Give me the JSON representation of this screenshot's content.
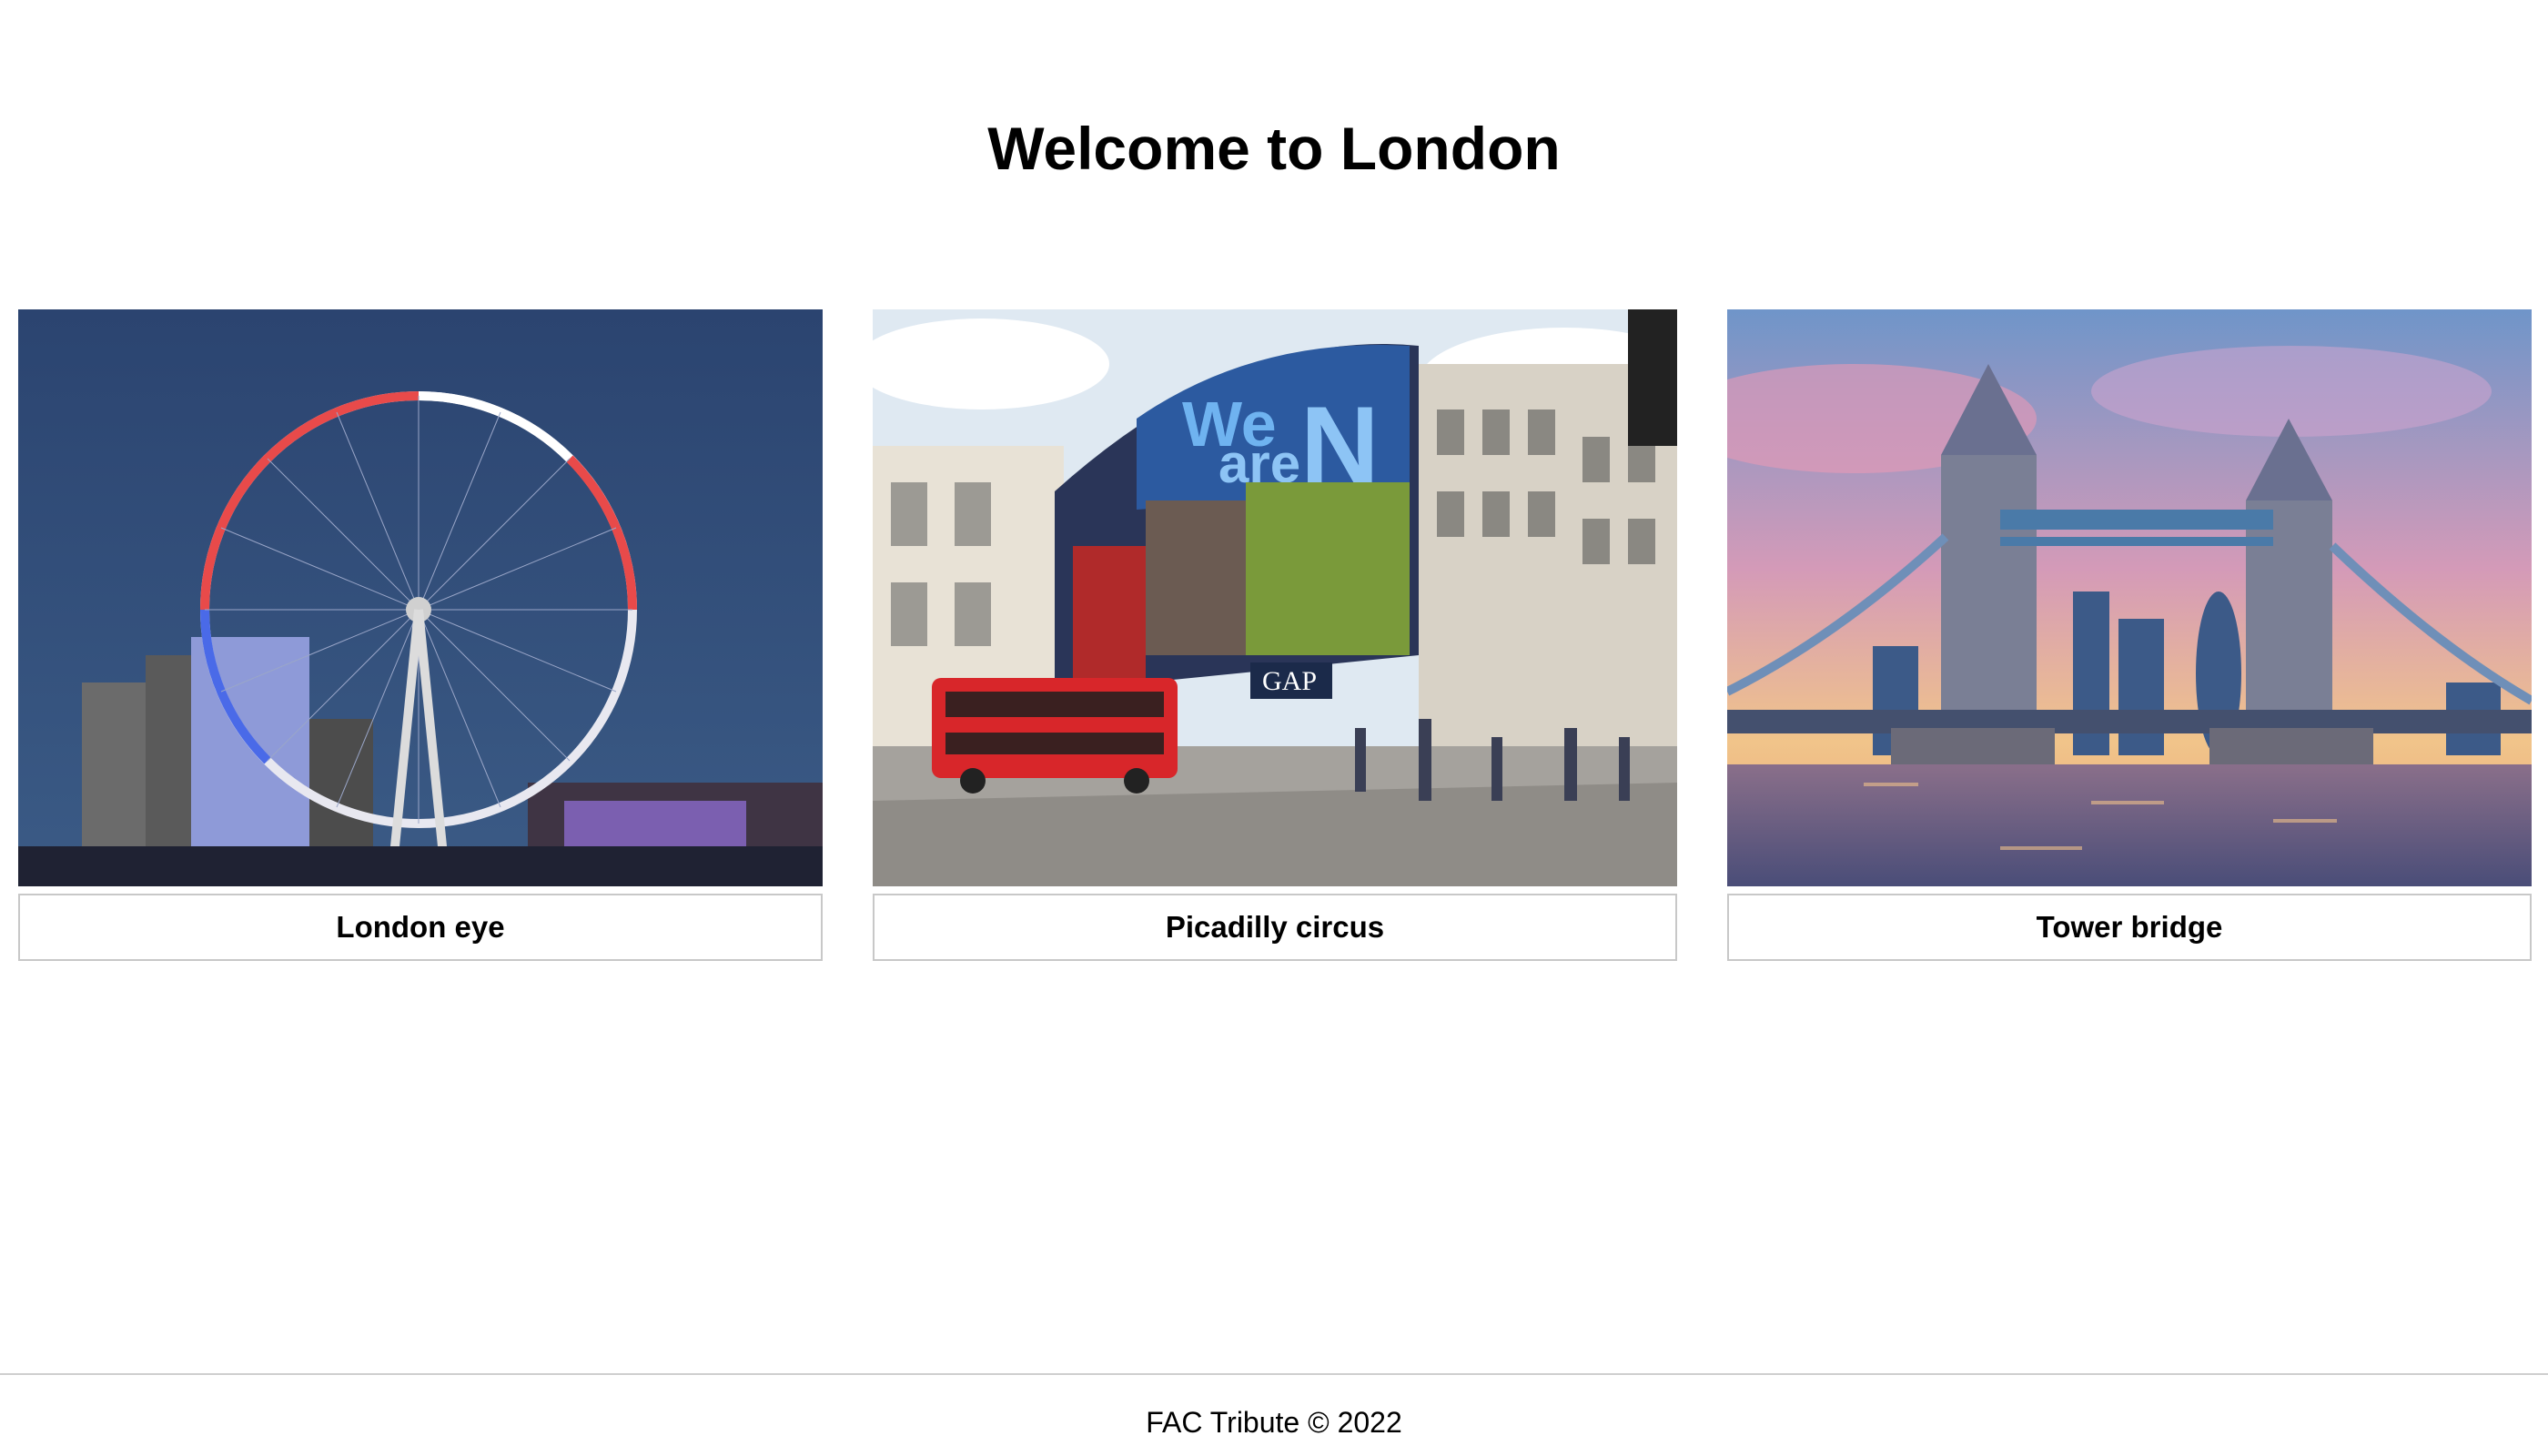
{
  "page": {
    "title": "Welcome to London"
  },
  "cards": [
    {
      "caption": "London eye",
      "image_icon": "london-eye-photo"
    },
    {
      "caption": "Picadilly circus",
      "image_icon": "picadilly-circus-photo"
    },
    {
      "caption": "Tower bridge",
      "image_icon": "tower-bridge-photo"
    }
  ],
  "picadilly_billboard": {
    "text_we": "We",
    "text_are": "are",
    "text_n": "N",
    "store_sign": "GAP"
  },
  "footer": {
    "text": "FAC Tribute © 2022"
  }
}
